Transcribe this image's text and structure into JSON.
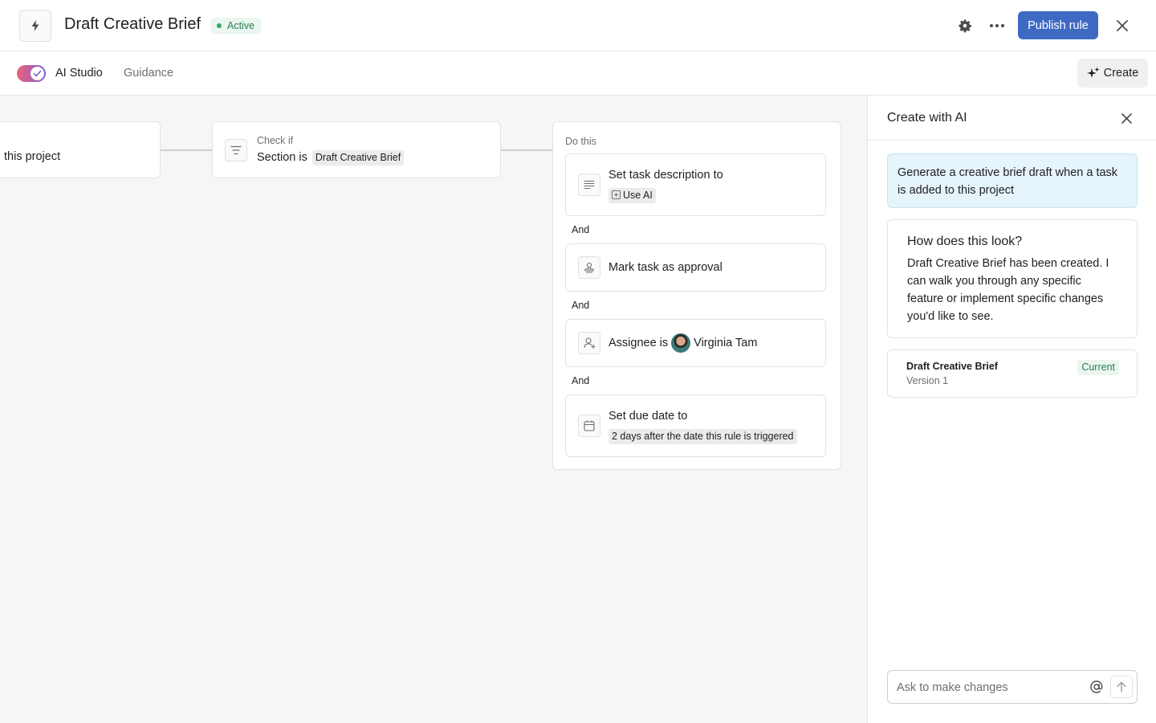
{
  "header": {
    "title": "Draft Creative Brief",
    "status": "Active",
    "publish_label": "Publish rule"
  },
  "subbar": {
    "ai_studio_label": "AI Studio",
    "guidance_label": "Guidance",
    "create_label": "Create"
  },
  "canvas": {
    "trigger_text": "this project",
    "condition": {
      "label": "Check if",
      "text": "Section is",
      "chip": "Draft Creative Brief"
    },
    "actions_label": "Do this",
    "and_label": "And",
    "actions": [
      {
        "title": "Set task description to",
        "chip": "Use AI",
        "icon": "text-lines-icon"
      },
      {
        "title": "Mark task as approval",
        "icon": "approval-stamp-icon"
      },
      {
        "title": "Assignee is",
        "person": "Virginia Tam",
        "icon": "add-person-icon"
      },
      {
        "title": "Set due date to",
        "chip": "2 days after the date this rule is triggered",
        "icon": "calendar-icon"
      }
    ]
  },
  "panel": {
    "title": "Create with AI",
    "prompt": "Generate a creative brief draft when a task is added to this project",
    "reply_title": "How does this look?",
    "reply_body": "Draft Creative Brief has been created. I can walk you through any specific feature or implement specific changes you'd like to see.",
    "version_name": "Draft Creative Brief",
    "version_number": "Version 1",
    "version_badge": "Current",
    "input_placeholder": "Ask to make changes"
  },
  "colors": {
    "primary_button": "#3f6ac4",
    "active_green": "#2a7d50",
    "prompt_bg": "#e6f4fb",
    "canvas_bg": "#f6f6f6"
  }
}
